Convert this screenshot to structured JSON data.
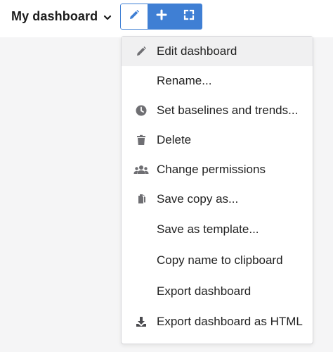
{
  "header": {
    "dashboard_title": "My dashboard",
    "chevron_icon": "chevron-down-icon",
    "toolbar": {
      "edit_icon": "pencil-icon",
      "add_icon": "plus-icon",
      "fullscreen_icon": "expand-icon",
      "accent_color": "#3f7fd4"
    }
  },
  "menu": {
    "items": [
      {
        "label": "Edit dashboard",
        "icon": "pencil-icon",
        "active": true
      },
      {
        "label": "Rename...",
        "icon": ""
      },
      {
        "label": "Set baselines and trends...",
        "icon": "clock-icon"
      },
      {
        "label": "Delete",
        "icon": "trash-icon"
      },
      {
        "label": "Change permissions",
        "icon": "users-icon"
      },
      {
        "label": "Save copy as...",
        "icon": "copy-icon"
      },
      {
        "label": "Save as template...",
        "icon": ""
      },
      {
        "label": "Copy name to clipboard",
        "icon": ""
      },
      {
        "label": "Export dashboard",
        "icon": ""
      },
      {
        "label": "Export dashboard as HTML",
        "icon": "download-icon"
      }
    ]
  }
}
